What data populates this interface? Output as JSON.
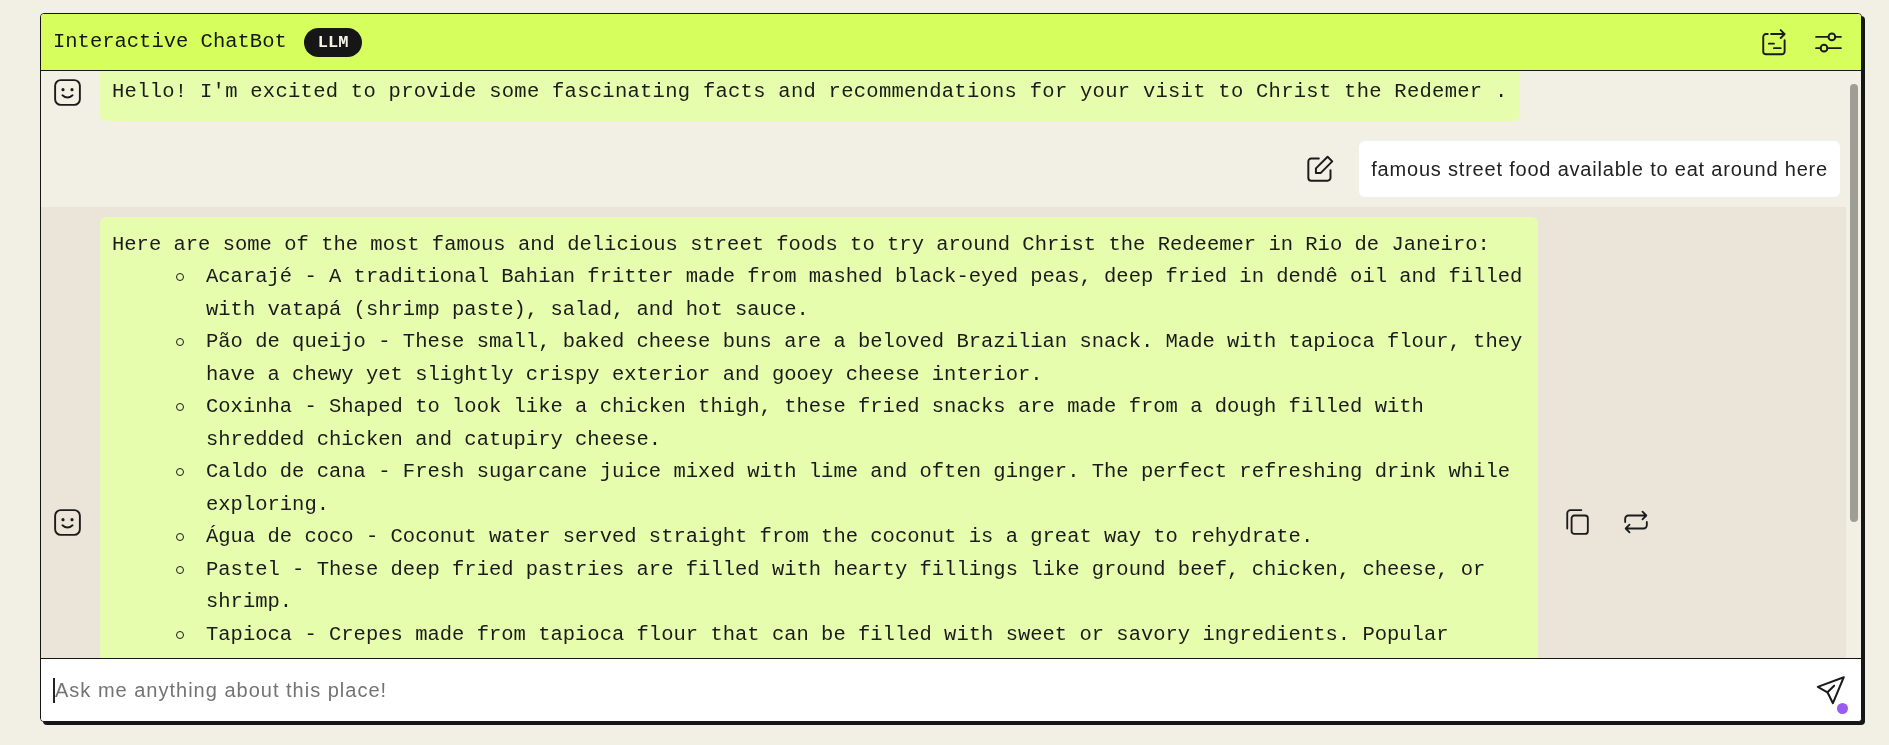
{
  "header": {
    "title": "Interactive ChatBot",
    "badge": "LLM"
  },
  "messages": [
    {
      "kind": "bot",
      "highlighted": false,
      "text": "Hello! I'm excited to provide some fascinating facts and recommendations for your visit to Christ the Redemer ."
    },
    {
      "kind": "user",
      "text": "famous street food available to eat around here"
    },
    {
      "kind": "bot",
      "highlighted": true,
      "text": "Here are some of the most famous and delicious street foods to try around Christ the Redeemer in Rio de Janeiro:",
      "items": [
        "Acarajé - A traditional Bahian fritter made from mashed black-eyed peas, deep fried in dendê oil and filled with vatapá (shrimp paste), salad, and hot sauce.",
        "Pão de queijo - These small, baked cheese buns are a beloved Brazilian snack. Made with tapioca flour, they have a chewy yet slightly crispy exterior and gooey cheese interior.",
        "Coxinha - Shaped to look like a chicken thigh, these fried snacks are made from a dough filled with shredded chicken and catupiry cheese.",
        "Caldo de cana - Fresh sugarcane juice mixed with lime and often ginger. The perfect refreshing drink while exploring.",
        "Água de coco - Coconut water served straight from the coconut is a great way to rehydrate.",
        "Pastel - These deep fried pastries are filled with hearty fillings like ground beef, chicken, cheese, or shrimp.",
        "Tapioca - Crepes made from tapioca flour that can be filled with sweet or savory ingredients. Popular"
      ]
    }
  ],
  "input": {
    "placeholder": "Ask me anything about this place!",
    "focused": true
  }
}
